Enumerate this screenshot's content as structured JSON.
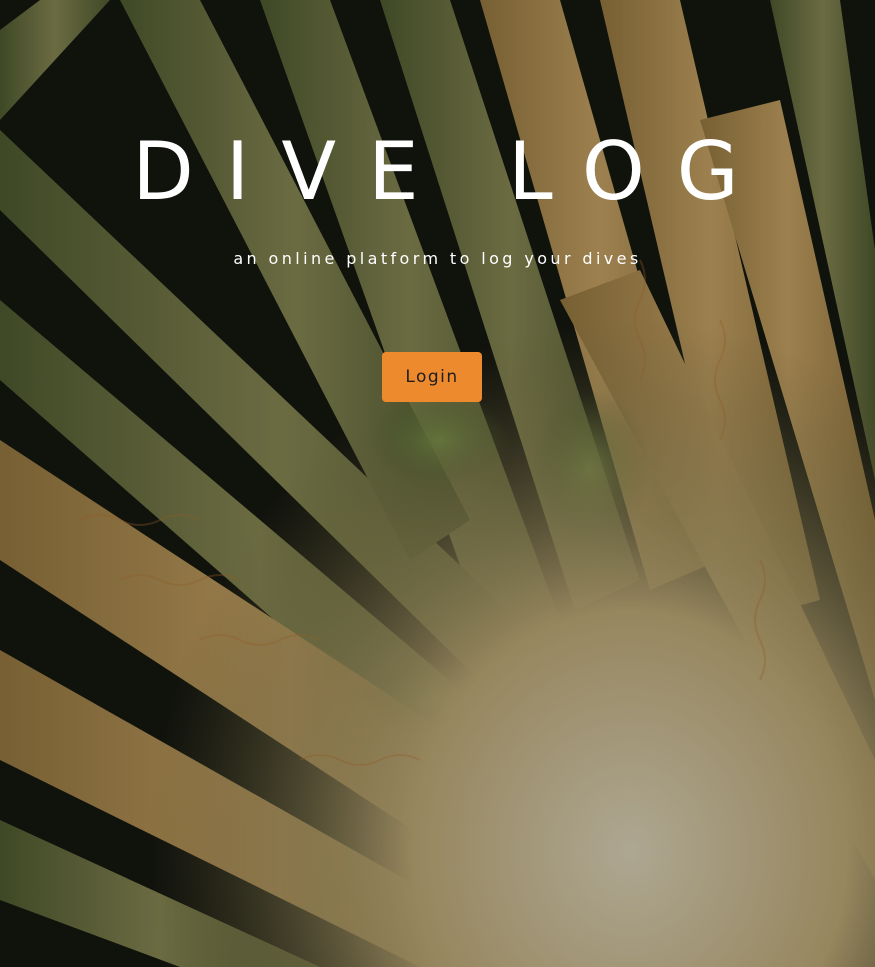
{
  "hero": {
    "title": "DIVE LOG",
    "subtitle": "an online platform to log your dives",
    "background_image": "close-up of a sea anemone with striped orange and green tentacles against a dark background"
  },
  "actions": {
    "login_label": "Login"
  },
  "colors": {
    "accent": "#ee8a2e",
    "title_text": "#ffffff",
    "button_text": "#1e1e1e"
  }
}
